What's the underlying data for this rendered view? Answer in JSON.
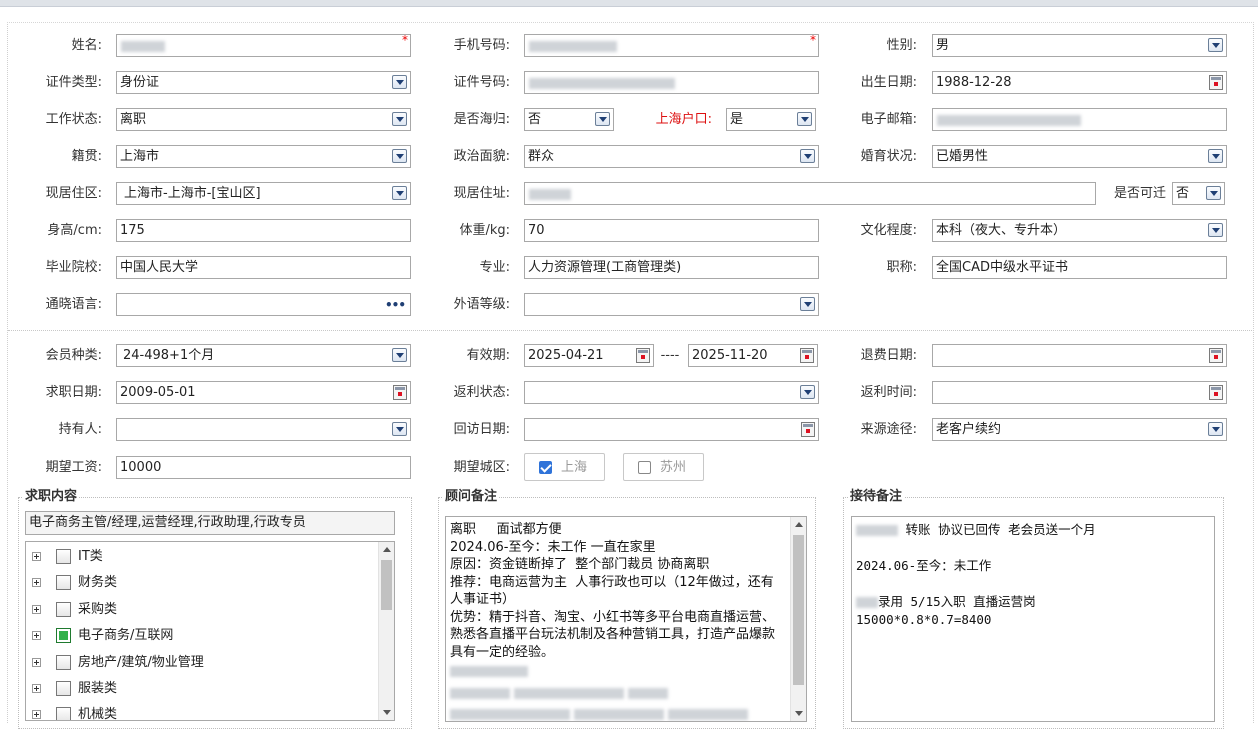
{
  "row1": {
    "name_label": "姓名:",
    "phone_label": "手机号码:",
    "gender_label": "性别:",
    "gender_value": "男"
  },
  "row2": {
    "id_type_label": "证件类型:",
    "id_type_value": "身份证",
    "id_number_label": "证件号码:",
    "birth_label": "出生日期:",
    "birth_value": "1988-12-28"
  },
  "row3": {
    "work_status_label": "工作状态:",
    "work_status_value": "离职",
    "returnee_label": "是否海归:",
    "returnee_value": "否",
    "hukou_label": "上海户口:",
    "hukou_value": "是",
    "email_label": "电子邮箱:"
  },
  "row4": {
    "native_label": "籍贯:",
    "native_value": "上海市",
    "political_label": "政治面貌:",
    "political_value": "群众",
    "marital_label": "婚育状况:",
    "marital_value": "已婚男性"
  },
  "row5": {
    "residence_area_label": "现居住区:",
    "residence_area_value": "上海市-上海市-[宝山区]",
    "address_label": "现居住址:",
    "relocate_label": "是否可迁",
    "relocate_value": "否"
  },
  "row6": {
    "height_label": "身高/cm:",
    "height_value": "175",
    "weight_label": "体重/kg:",
    "weight_value": "70",
    "education_label": "文化程度:",
    "education_value": "本科（夜大、专升本）"
  },
  "row7": {
    "school_label": "毕业院校:",
    "school_value": "中国人民大学",
    "major_label": "专业:",
    "major_value": "人力资源管理(工商管理类)",
    "title_label": "职称:",
    "title_value": "全国CAD中级水平证书"
  },
  "row8": {
    "language_label": "通晓语言:",
    "foreign_level_label": "外语等级:"
  },
  "row9": {
    "member_type_label": "会员种类:",
    "member_type_value": "24-498+1个月",
    "validity_label": "有效期:",
    "validity_start": "2025-04-21",
    "validity_sep": "----",
    "validity_end": "2025-11-20",
    "refund_date_label": "退费日期:"
  },
  "row10": {
    "job_date_label": "求职日期:",
    "job_date_value": "2009-05-01",
    "rebate_status_label": "返利状态:",
    "rebate_time_label": "返利时间:"
  },
  "row11": {
    "holder_label": "持有人:",
    "visit_date_label": "回访日期:",
    "source_label": "来源途径:",
    "source_value": "老客户续约"
  },
  "row12": {
    "salary_label": "期望工资:",
    "salary_value": "10000",
    "city_label": "期望城区:",
    "city_shanghai": "上海",
    "city_shanghai_checked": true,
    "city_suzhou": "苏州",
    "city_suzhou_checked": false
  },
  "job_panel": {
    "title": "求职内容",
    "summary": "电子商务主管/经理,运营经理,行政助理,行政专员",
    "tree": [
      {
        "label": "IT类",
        "checked": false
      },
      {
        "label": "财务类",
        "checked": false
      },
      {
        "label": "采购类",
        "checked": false
      },
      {
        "label": "电子商务/互联网",
        "checked": true
      },
      {
        "label": "房地产/建筑/物业管理",
        "checked": false
      },
      {
        "label": "服装类",
        "checked": false
      },
      {
        "label": "机械类",
        "checked": false
      }
    ]
  },
  "advisor_panel": {
    "title": "顾问备注",
    "lines": [
      "离职     面试都方便",
      "2024.06-至今：未工作 一直在家里",
      "原因：资金链断掉了  整个部门裁员 协商离职",
      "推荐：电商运营为主  人事行政也可以（12年做过，还有人事证书）",
      "优势：精于抖音、淘宝、小红书等多平台电商直播运营、熟悉各直播平台玩法机制及各种营销工具，打造产品爆款具有一定的经验。"
    ]
  },
  "reception_panel": {
    "title": "接待备注",
    "line1": "转账  协议已回传 老会员送一个月",
    "line2": "2024.06-至今：未工作",
    "line3": "录用  5/15入职 直播运营岗",
    "line4": "15000*0.8*0.7=8400"
  }
}
